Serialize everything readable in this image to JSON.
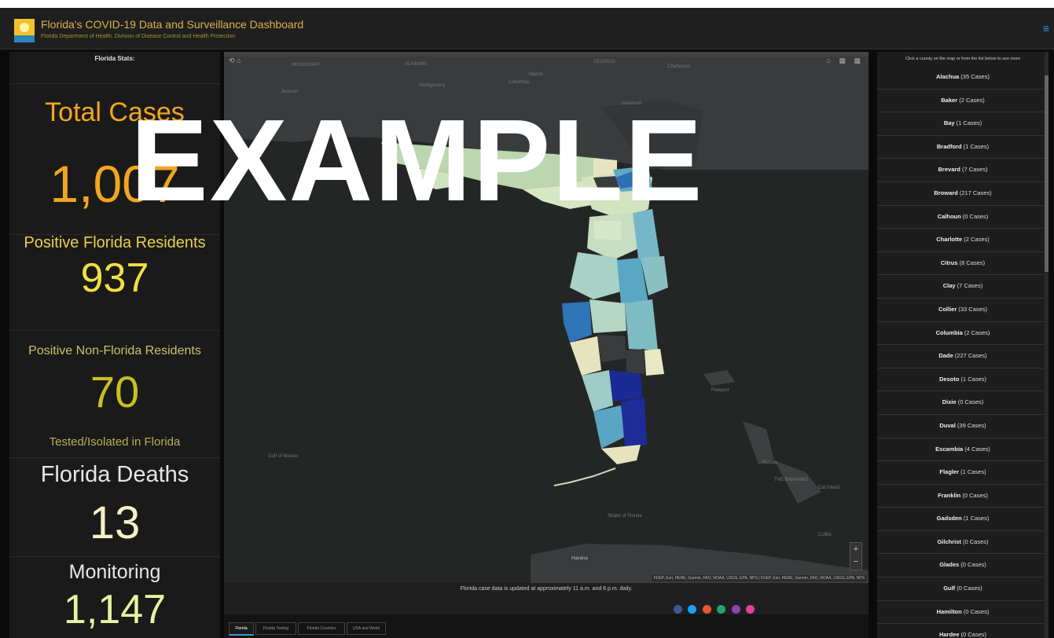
{
  "header": {
    "title": "Florida's COVID-19 Data and Surveillance Dashboard",
    "subtitle": "Florida Department of Health, Division of Disease Control and Health Protection",
    "menu_glyph": "≡"
  },
  "stats": {
    "header": "Florida Stats:",
    "total_cases_label": "Total Cases",
    "total_cases_value": "1,007",
    "positive_residents_label": "Positive Florida Residents",
    "positive_residents_value": "937",
    "non_residents_label": "Positive Non-Florida Residents",
    "non_residents_value": "70",
    "tested_label": "Tested/Isolated in Florida",
    "deaths_label": "Florida Deaths",
    "deaths_value": "13",
    "monitoring_label": "Monitoring",
    "monitoring_value": "1,147"
  },
  "map": {
    "labels": {
      "mississippi": "MISSISSIPPI",
      "alabama": "ALABAMA",
      "georgia": "GEORGIA",
      "jackson": "Jackson",
      "montgomery": "Montgomery",
      "columbus": "Columbus",
      "macon": "Macon",
      "savannah": "Savannah",
      "charleston": "Charleston",
      "gulf_of_mexico": "Gulf of Mexico",
      "freeport": "Freeport",
      "nassau": "Nassau",
      "the_bahamas": "THE BAHAMAS",
      "cat_island": "Cat Island",
      "havana": "Havana",
      "straits_of_florida": "Straits of Florida",
      "cuba": "CUBA"
    },
    "attribution": "FDEP, Esri, HERE, Garmin, FAO, NOAA, USGS, EPA, NPS | FDEP, Esri, HERE, Garmin, FAO, NOAA, USGS, EPA, NPS",
    "tools_left": "⟲ ⌂",
    "tools_right": "⌂ ▦ ▦",
    "zoom_in": "+",
    "zoom_out": "−"
  },
  "update_note": "Florida case data is updated at approximately 11 a.m. and 6 p.m. daily.",
  "social_colors": [
    "#3b5998",
    "#1da1f2",
    "#e8562a",
    "#25a36f",
    "#8e44ad",
    "#e0419b"
  ],
  "tabs": [
    "Florida",
    "Florida Testing",
    "Florida Counties",
    "USA and World"
  ],
  "counties": {
    "header": "Click a county on the map or from the list below to see more",
    "items": [
      {
        "name": "Alachua",
        "cases": "(35 Cases)"
      },
      {
        "name": "Baker",
        "cases": "(2 Cases)"
      },
      {
        "name": "Bay",
        "cases": "(1 Cases)"
      },
      {
        "name": "Bradford",
        "cases": "(1 Cases)"
      },
      {
        "name": "Brevard",
        "cases": "(7 Cases)"
      },
      {
        "name": "Broward",
        "cases": "(217 Cases)"
      },
      {
        "name": "Calhoun",
        "cases": "(0 Cases)"
      },
      {
        "name": "Charlotte",
        "cases": "(2 Cases)"
      },
      {
        "name": "Citrus",
        "cases": "(8 Cases)"
      },
      {
        "name": "Clay",
        "cases": "(7 Cases)"
      },
      {
        "name": "Collier",
        "cases": "(33 Cases)"
      },
      {
        "name": "Columbia",
        "cases": "(2 Cases)"
      },
      {
        "name": "Dade",
        "cases": "(227 Cases)"
      },
      {
        "name": "Desoto",
        "cases": "(1 Cases)"
      },
      {
        "name": "Dixie",
        "cases": "(0 Cases)"
      },
      {
        "name": "Duval",
        "cases": "(39 Cases)"
      },
      {
        "name": "Escambia",
        "cases": "(4 Cases)"
      },
      {
        "name": "Flagler",
        "cases": "(1 Cases)"
      },
      {
        "name": "Franklin",
        "cases": "(0 Cases)"
      },
      {
        "name": "Gadsden",
        "cases": "(1 Cases)"
      },
      {
        "name": "Gilchrist",
        "cases": "(0 Cases)"
      },
      {
        "name": "Glades",
        "cases": "(0 Cases)"
      },
      {
        "name": "Gulf",
        "cases": "(0 Cases)"
      },
      {
        "name": "Hamilton",
        "cases": "(0 Cases)"
      },
      {
        "name": "Hardee",
        "cases": "(0 Cases)"
      }
    ]
  },
  "watermark": "EXAMPLE"
}
